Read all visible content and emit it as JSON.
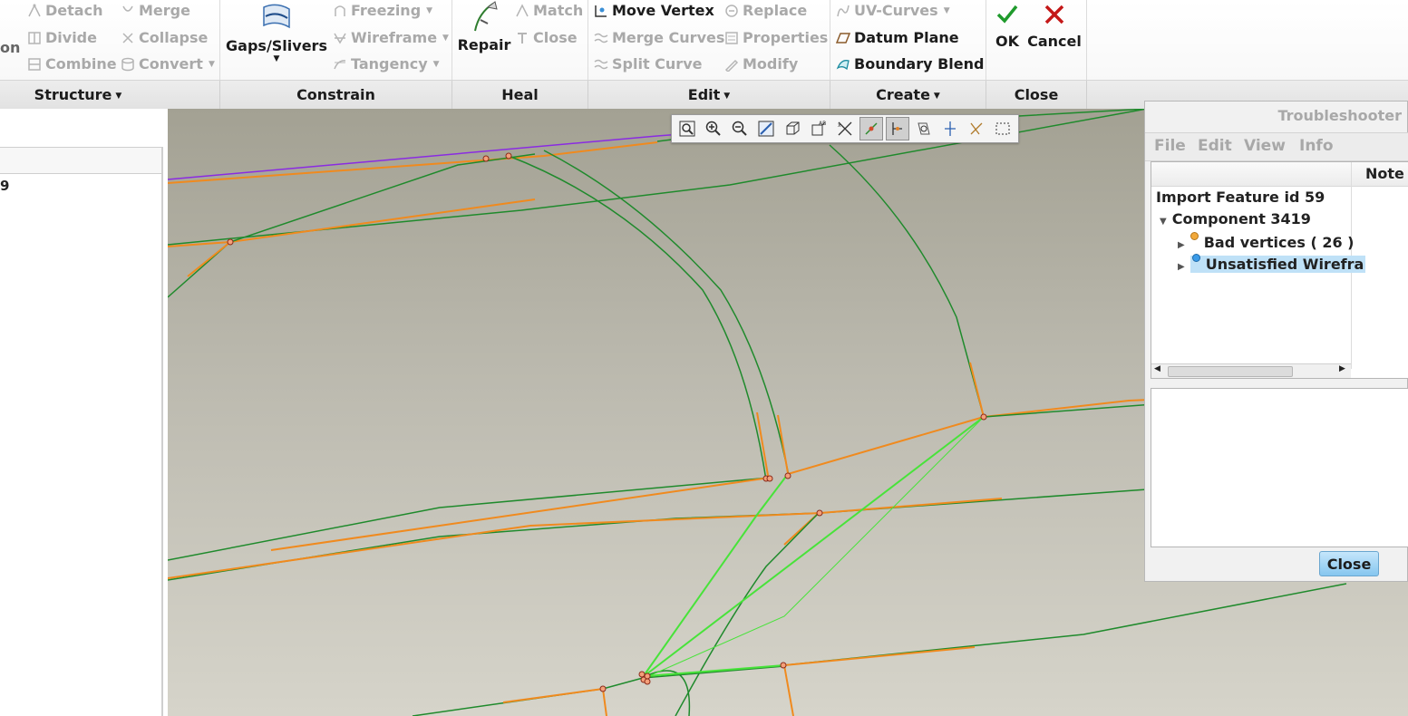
{
  "ribbon": {
    "structure": {
      "cut_label": "on",
      "detach": "Detach",
      "divide": "Divide",
      "combine": "Combine",
      "merge": "Merge",
      "collapse": "Collapse",
      "convert": "Convert",
      "group_label": "Structure"
    },
    "constrain": {
      "gaps_slivers": "Gaps/Slivers",
      "freezing": "Freezing",
      "wireframe": "Wireframe",
      "tangency": "Tangency",
      "group_label": "Constrain"
    },
    "heal": {
      "repair": "Repair",
      "match": "Match",
      "close": "Close",
      "group_label": "Heal"
    },
    "edit": {
      "move_vertex": "Move Vertex",
      "merge_curves": "Merge Curves",
      "split_curve": "Split Curve",
      "replace": "Replace",
      "properties": "Properties",
      "modify": "Modify",
      "group_label": "Edit"
    },
    "create": {
      "uv_curves": "UV-Curves",
      "datum_plane": "Datum Plane",
      "boundary_blend": "Boundary Blend",
      "group_label": "Create"
    },
    "close": {
      "ok": "OK",
      "cancel": "Cancel",
      "group_label": "Close"
    }
  },
  "left_panel": {
    "row_fragment": "9"
  },
  "view_toolbar": {
    "icons": [
      "refit-icon",
      "zoom-in-icon",
      "zoom-out-icon",
      "repaint-icon",
      "view-orientation-icon",
      "saved-orientations-icon",
      "annotation-display-icon",
      "point-display-icon",
      "wireframe-display-icon",
      "plane-display-icon",
      "axis-display-icon",
      "csys-display-icon",
      "selection-box-icon"
    ],
    "active_indices": [
      7,
      8
    ]
  },
  "troubleshooter": {
    "title": "Troubleshooter",
    "menu": [
      "File",
      "Edit",
      "View",
      "Info"
    ],
    "note_header": "Note",
    "tree": {
      "root": "Import Feature id 59",
      "component": "Component 3419",
      "bad_vertices": "Bad vertices ( 26 )",
      "unsatisfied": "Unsatisfied Wirefra"
    },
    "close_button": "Close"
  },
  "colors": {
    "curve_green": "#1f8a2c",
    "highlight_green": "#48e33a",
    "orange_edge": "#f08a1e",
    "vertex_fill": "#f4a07a",
    "purple_edge": "#8a2be2"
  }
}
